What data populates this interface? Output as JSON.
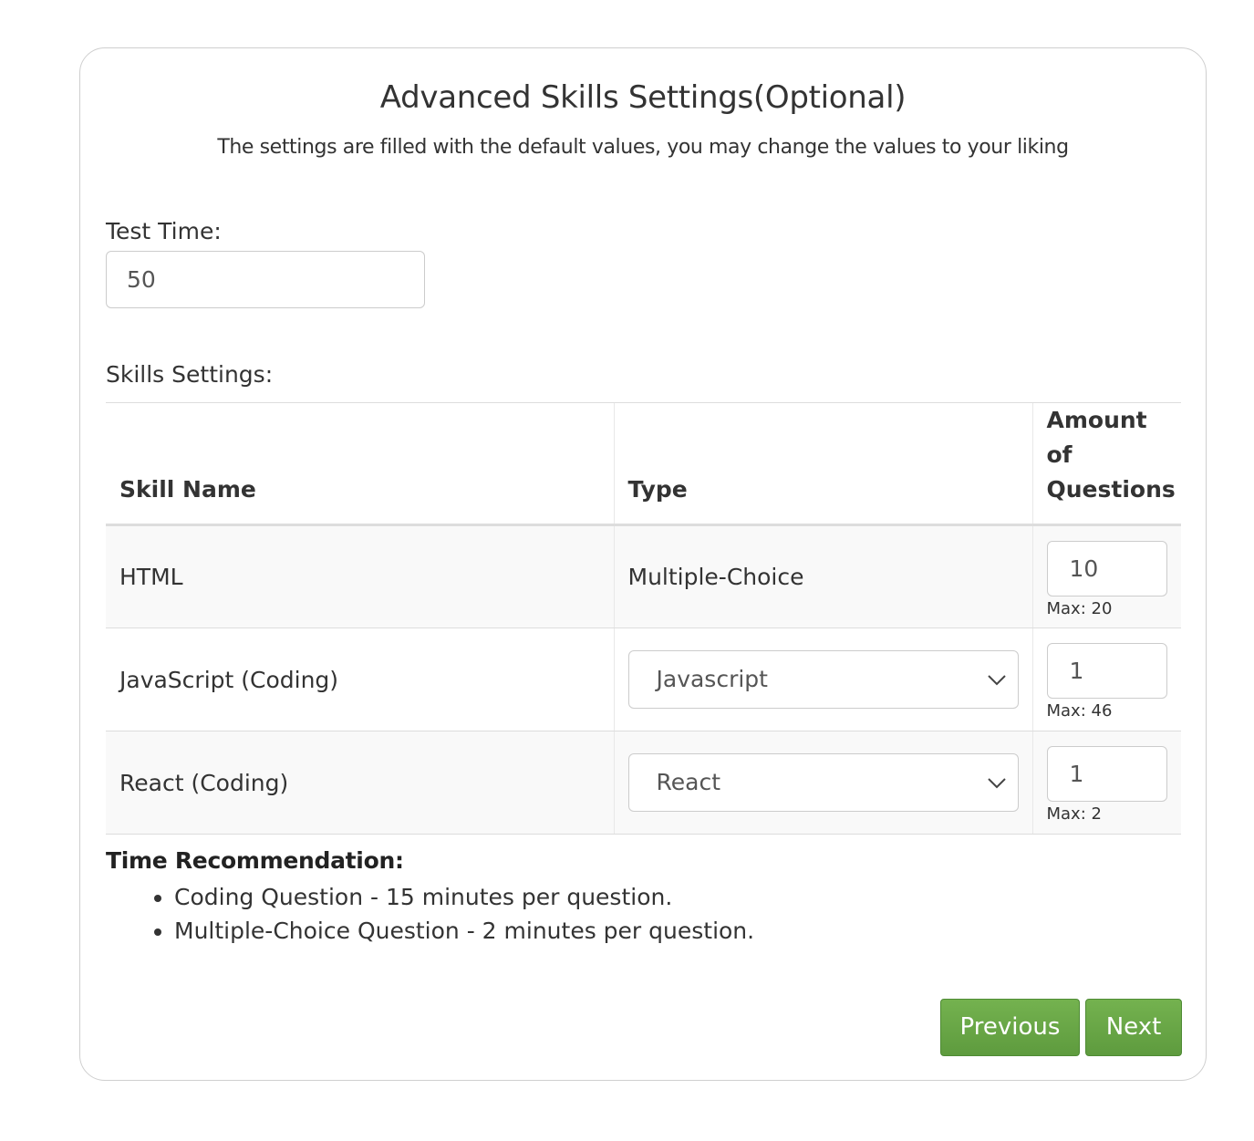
{
  "header": {
    "title": "Advanced Skills Settings(Optional)",
    "subtitle": "The settings are filled with the default values, you may change the values to your liking"
  },
  "test_time": {
    "label": "Test Time:",
    "value": "50"
  },
  "skills": {
    "label": "Skills Settings:",
    "columns": {
      "name": "Skill Name",
      "type": "Type",
      "amount": "Amount of Questions"
    },
    "rows": [
      {
        "name": "HTML",
        "type": "Multiple-Choice",
        "amount": "10",
        "max": "Max: 20"
      },
      {
        "name": "JavaScript (Coding)",
        "type": "Javascript",
        "amount": "1",
        "max": "Max: 46"
      },
      {
        "name": "React (Coding)",
        "type": "React",
        "amount": "1",
        "max": "Max: 2"
      }
    ]
  },
  "recommendation": {
    "title": "Time Recommendation:",
    "items": [
      "Coding Question - 15 minutes per question.",
      "Multiple-Choice Question - 2 minutes per question."
    ]
  },
  "buttons": {
    "previous": "Previous",
    "next": "Next"
  },
  "colors": {
    "button_green": "#67a544",
    "border": "#cccccc",
    "stripe": "#f9f9f9"
  }
}
